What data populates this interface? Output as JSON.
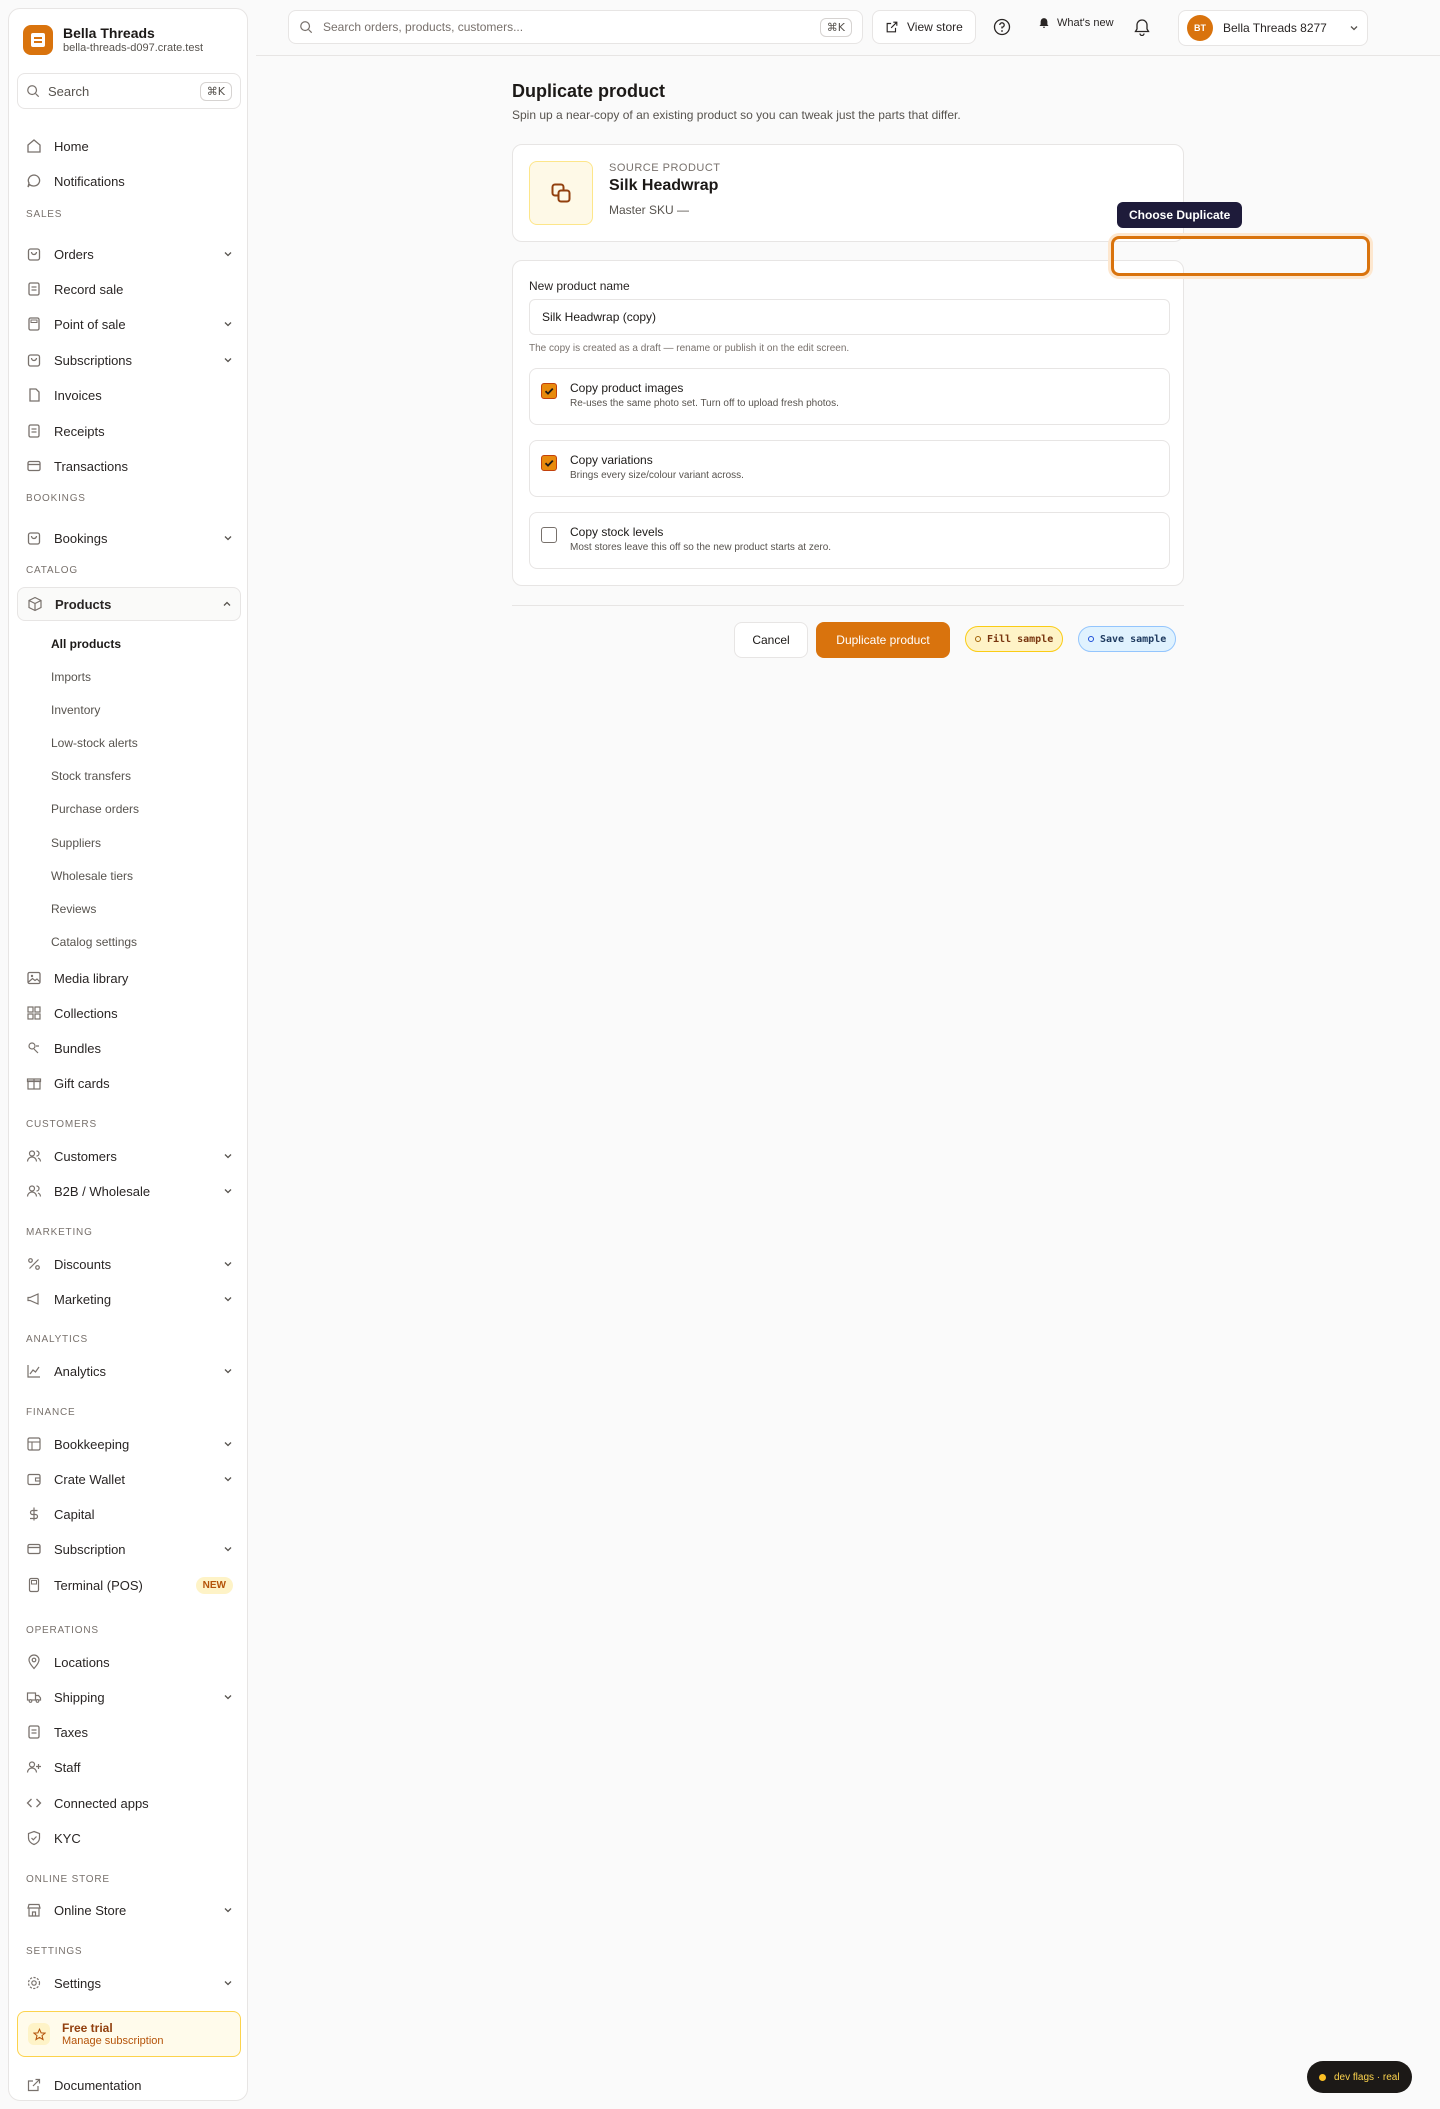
{
  "brand": {
    "name": "Bella Threads",
    "domain": "bella-threads-d097.crate.test"
  },
  "sidebar": {
    "search": {
      "label": "Search",
      "shortcut": "⌘K"
    },
    "top_items": [
      {
        "label": "Home",
        "icon": "home-icon"
      },
      {
        "label": "Notifications",
        "icon": "chat-bubble-icon"
      }
    ],
    "sections": {
      "sales": "SALES",
      "bookings": "BOOKINGS",
      "catalog": "CATALOG",
      "customers": "CUSTOMERS",
      "marketing": "MARKETING",
      "analytics": "ANALYTICS",
      "finance": "FINANCE",
      "operations": "OPERATIONS",
      "online_store": "ONLINE STORE",
      "settings": "SETTINGS"
    },
    "sales": [
      "Orders",
      "Record sale",
      "Point of sale",
      "Subscriptions",
      "Invoices",
      "Receipts",
      "Transactions"
    ],
    "bookings": [
      "Bookings"
    ],
    "catalog": {
      "products": "Products",
      "sub_items": [
        "All products",
        "Imports",
        "Inventory",
        "Low-stock alerts",
        "Stock transfers",
        "Purchase orders",
        "Suppliers",
        "Wholesale tiers",
        "Reviews",
        "Catalog settings"
      ],
      "other": [
        "Media library",
        "Collections",
        "Bundles",
        "Gift cards"
      ]
    },
    "customers": [
      "Customers",
      "B2B / Wholesale"
    ],
    "marketing": [
      "Discounts",
      "Marketing"
    ],
    "analytics": [
      "Analytics"
    ],
    "finance": [
      "Bookkeeping",
      "Crate Wallet",
      "Capital",
      "Subscription",
      "Terminal (POS)"
    ],
    "new_badge": "NEW",
    "operations": [
      "Locations",
      "Shipping",
      "Taxes",
      "Staff",
      "Connected apps",
      "KYC"
    ],
    "online_store": [
      "Online Store"
    ],
    "settings": [
      "Settings"
    ],
    "trial": {
      "title": "Free trial",
      "subtitle": "Manage subscription"
    },
    "documentation": "Documentation"
  },
  "topbar": {
    "search_placeholder": "Search orders, products, customers...",
    "search_shortcut": "⌘K",
    "view_store": "View store",
    "whats_new": "What's new",
    "account": {
      "initials": "BT",
      "name": "Bella Threads 8277"
    }
  },
  "page": {
    "title": "Duplicate product",
    "subtitle": "Spin up a near-copy of an existing product so you can tweak just the parts that differ."
  },
  "source": {
    "kicker": "SOURCE PRODUCT",
    "name": "Silk Headwrap",
    "sku": "Master SKU —"
  },
  "form": {
    "name_label": "New product name",
    "name_value": "Silk Headwrap (copy)",
    "help": "The copy is created as a draft — rename or publish it on the edit screen.",
    "options": [
      {
        "title": "Copy product images",
        "desc": "Re-uses the same photo set. Turn off to upload fresh photos.",
        "checked": true
      },
      {
        "title": "Copy variations",
        "desc": "Brings every size/colour variant across.",
        "checked": true
      },
      {
        "title": "Copy stock levels",
        "desc": "Most stores leave this off so the new product starts at zero.",
        "checked": false
      }
    ]
  },
  "actions": {
    "cancel": "Cancel",
    "submit": "Duplicate product",
    "fill_sample": "Fill sample",
    "save_sample": "Save sample"
  },
  "overlay": {
    "tooltip": "Choose Duplicate"
  },
  "dev_flags": "dev flags · real",
  "colors": {
    "accent": "#d9730d",
    "tooltip_bg": "#1e1b3a"
  }
}
